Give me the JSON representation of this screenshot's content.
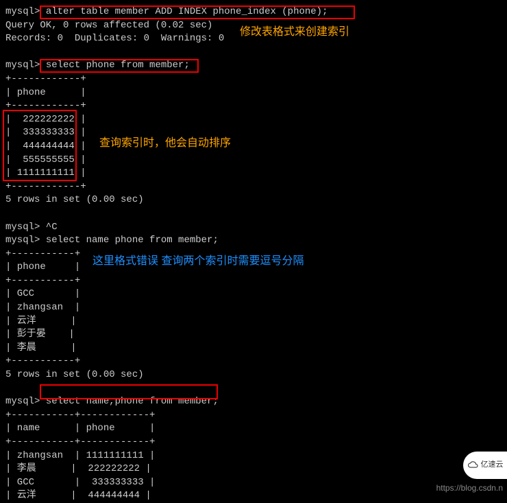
{
  "prompt": "mysql> ",
  "cmd1": "alter table member ADD INDEX phone_index (phone);",
  "resp1a": "Query OK, 0 rows affected (0.02 sec)",
  "resp1b": "Records: 0  Duplicates: 0  Warnings: 0",
  "annotation1": "修改表格式来创建索引",
  "cmd2": "select phone from member;",
  "table2": {
    "border": "+------------+",
    "header": "| phone      |",
    "rows": [
      "|  222222222 |",
      "|  333333333 |",
      "|  444444444 |",
      "|  555555555 |",
      "| 1111111111 |"
    ],
    "footer": "5 rows in set (0.00 sec)"
  },
  "annotation2": "查询索引时，他会自动排序",
  "ctrlc_line": "mysql> ^C",
  "cmd3": "select name phone from member;",
  "annotation3": "这里格式错误 查询两个索引时需要逗号分隔",
  "table3": {
    "border": "+-----------+",
    "header": "| phone     |",
    "rows": [
      "| GCC       |",
      "| zhangsan  |",
      "| 云洋      |",
      "| 彭于晏    |",
      "| 李晨      |"
    ],
    "footer": "5 rows in set (0.00 sec)"
  },
  "cmd4": "select name,phone from member;",
  "table4": {
    "border": "+-----------+------------+",
    "header": "| name      | phone      |",
    "rows": [
      "| zhangsan  | 1111111111 |",
      "| 李晨      |  222222222 |",
      "| GCC       |  333333333 |",
      "| 云洋      |  444444444 |"
    ]
  },
  "watermark_url": "https://blog.csdn.n",
  "logo_text": "亿速云",
  "chart_data": {
    "type": "table",
    "tables": [
      {
        "title": "select phone from member",
        "columns": [
          "phone"
        ],
        "rows": [
          [
            222222222
          ],
          [
            333333333
          ],
          [
            444444444
          ],
          [
            555555555
          ],
          [
            1111111111
          ]
        ]
      },
      {
        "title": "select name phone from member (alias error)",
        "columns": [
          "phone"
        ],
        "rows": [
          [
            "GCC"
          ],
          [
            "zhangsan"
          ],
          [
            "云洋"
          ],
          [
            "彭于晏"
          ],
          [
            "李晨"
          ]
        ]
      },
      {
        "title": "select name,phone from member",
        "columns": [
          "name",
          "phone"
        ],
        "rows": [
          [
            "zhangsan",
            1111111111
          ],
          [
            "李晨",
            222222222
          ],
          [
            "GCC",
            333333333
          ],
          [
            "云洋",
            444444444
          ]
        ]
      }
    ]
  }
}
